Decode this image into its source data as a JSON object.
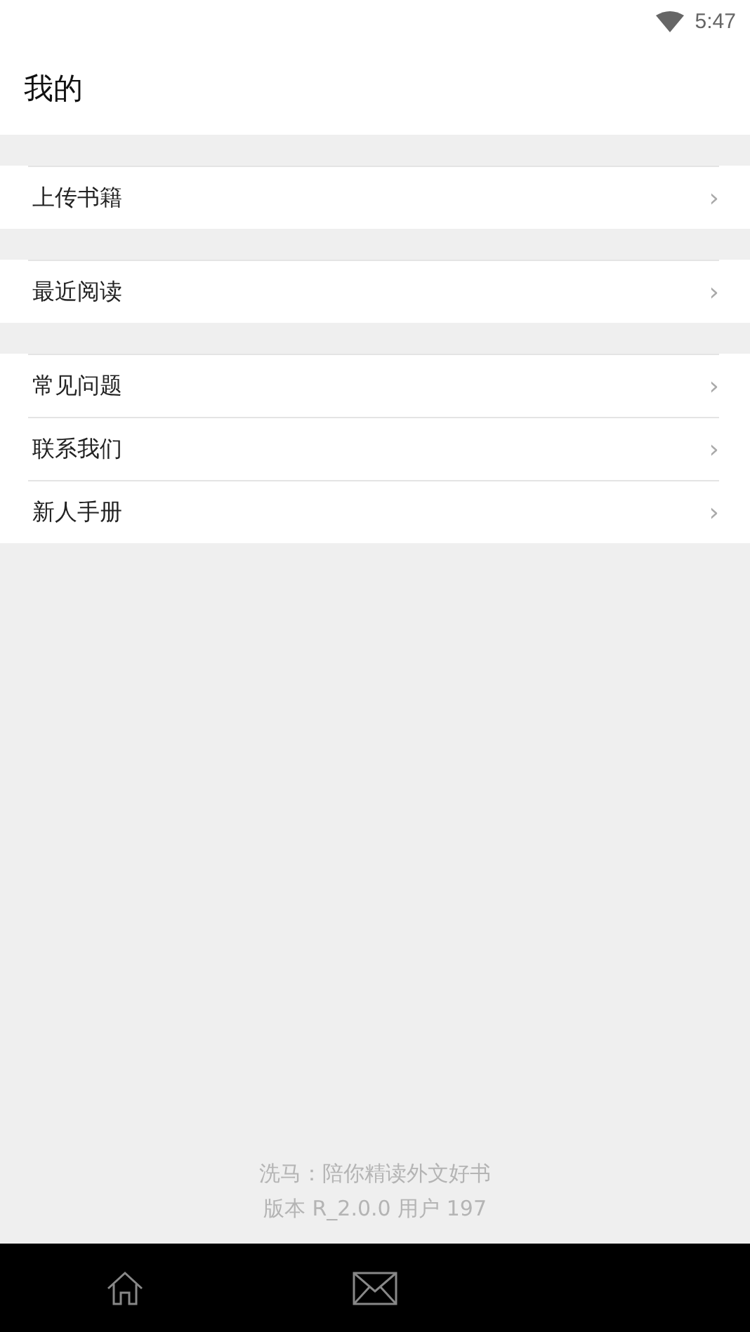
{
  "status_bar": {
    "time": "5:47"
  },
  "header": {
    "title": "我的"
  },
  "menu_groups": [
    {
      "items": [
        {
          "label": "上传书籍",
          "chevron": "›"
        }
      ]
    },
    {
      "items": [
        {
          "label": "最近阅读",
          "chevron": "›"
        }
      ]
    },
    {
      "items": [
        {
          "label": "常见问题",
          "chevron": "›"
        },
        {
          "label": "联系我们",
          "chevron": "›"
        },
        {
          "label": "新人手册",
          "chevron": "›"
        }
      ]
    }
  ],
  "footer": {
    "slogan": "洗马：陪你精读外文好书",
    "version": "版本 R_2.0.0 用户 197"
  },
  "bottom_nav": [
    {
      "kind": "home"
    },
    {
      "kind": "mail"
    }
  ]
}
